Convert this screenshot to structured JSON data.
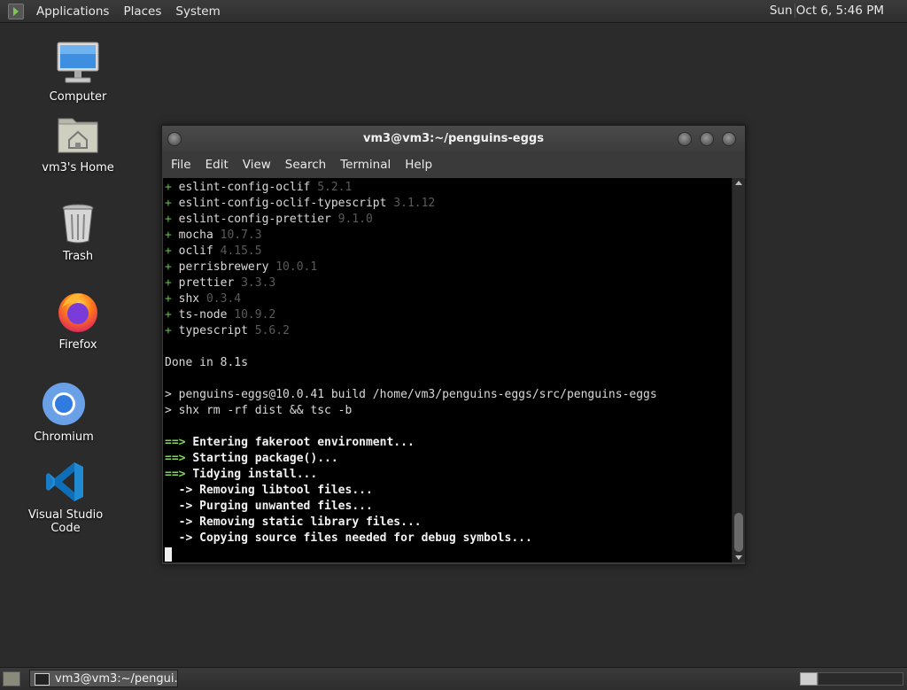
{
  "top_panel": {
    "menus": [
      "Applications",
      "Places",
      "System"
    ],
    "clock": "Sun Oct  6,  5:46 PM"
  },
  "desktop_icons": [
    {
      "label": "Computer",
      "icon": "computer-icon"
    },
    {
      "label": "vm3's Home",
      "icon": "home-folder-icon"
    },
    {
      "label": "Trash",
      "icon": "trash-icon"
    },
    {
      "label": "Firefox",
      "icon": "firefox-icon"
    },
    {
      "label": "Chromium",
      "icon": "chromium-icon"
    },
    {
      "label": "Visual Studio Code",
      "icon": "vscode-icon"
    }
  ],
  "terminal": {
    "title": "vm3@vm3:~/penguins-eggs",
    "menu": [
      "File",
      "Edit",
      "View",
      "Search",
      "Terminal",
      "Help"
    ],
    "packages": [
      {
        "name": "eslint-config-oclif",
        "version": "5.2.1"
      },
      {
        "name": "eslint-config-oclif-typescript",
        "version": "3.1.12"
      },
      {
        "name": "eslint-config-prettier",
        "version": "9.1.0"
      },
      {
        "name": "mocha",
        "version": "10.7.3"
      },
      {
        "name": "oclif",
        "version": "4.15.5"
      },
      {
        "name": "perrisbrewery",
        "version": "10.0.1"
      },
      {
        "name": "prettier",
        "version": "3.3.3"
      },
      {
        "name": "shx",
        "version": "0.3.4"
      },
      {
        "name": "ts-node",
        "version": "10.9.2"
      },
      {
        "name": "typescript",
        "version": "5.6.2"
      }
    ],
    "done": "Done in 8.1s",
    "commands": [
      "penguins-eggs@10.0.41 build /home/vm3/penguins-eggs/src/penguins-eggs",
      "shx rm -rf dist && tsc -b"
    ],
    "steps": [
      "Entering fakeroot environment...",
      "Starting package()...",
      "Tidying install..."
    ],
    "substeps": [
      "Removing libtool files...",
      "Purging unwanted files...",
      "Removing static library files...",
      "Copying source files needed for debug symbols..."
    ],
    "plus_marker": "+",
    "prompt_marker": ">",
    "step_marker": "==>",
    "substep_marker": "->"
  },
  "taskbar": {
    "task_label": "vm3@vm3:~/pengui..."
  }
}
